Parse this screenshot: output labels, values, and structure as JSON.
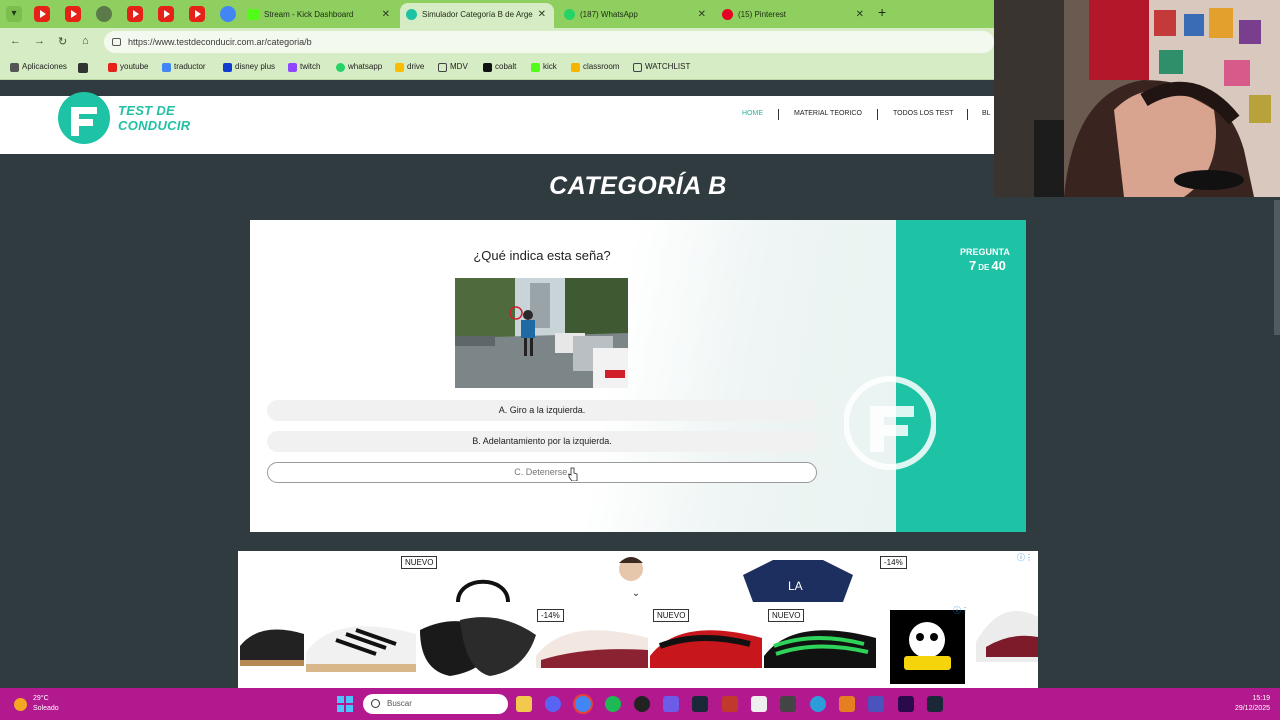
{
  "browser": {
    "tabs": [
      {
        "title": "Stream - Kick Dashboard",
        "active": false
      },
      {
        "title": "Simulador Categoría B de Arge",
        "active": true
      },
      {
        "title": "(187) WhatsApp",
        "active": false
      },
      {
        "title": "(15) Pinterest",
        "active": false
      }
    ],
    "url": "https://www.testdeconducir.com.ar/categoria/b",
    "bookmarks": [
      "Aplicaciones",
      "youtube",
      "traductor",
      "disney plus",
      "twitch",
      "whatsapp",
      "drive",
      "MDV",
      "cobalt",
      "kick",
      "classroom",
      "WATCHLIST"
    ]
  },
  "site": {
    "logo_line1": "TEST DE",
    "logo_line2": "CONDUCIR",
    "nav": [
      "HOME",
      "MATERIAL TEORICO",
      "TODOS LOS TEST",
      "BL"
    ],
    "page_title": "CATEGORÍA B"
  },
  "quiz": {
    "question": "¿Qué indica esta seña?",
    "answers": [
      "A. Giro a la izquierda.",
      "B. Adelantamiento por la izquierda.",
      "C. Detenerse."
    ],
    "counter_label": "PREGUNTA",
    "current": "7",
    "de": "DE",
    "total": "40"
  },
  "ads": {
    "badges": [
      "NUEVO",
      "-14%",
      "-14%",
      "NUEVO",
      "NUEVO"
    ]
  },
  "taskbar": {
    "temperature": "29°C",
    "weather": "Soleado",
    "search_placeholder": "Buscar",
    "time": "15:19",
    "date": "29/12/2025"
  },
  "colors": {
    "brand_teal": "#1ec3a5",
    "chrome_green": "#8ecf5f",
    "taskbar_magenta": "#b3198f",
    "page_bg": "#2f3b3e"
  }
}
